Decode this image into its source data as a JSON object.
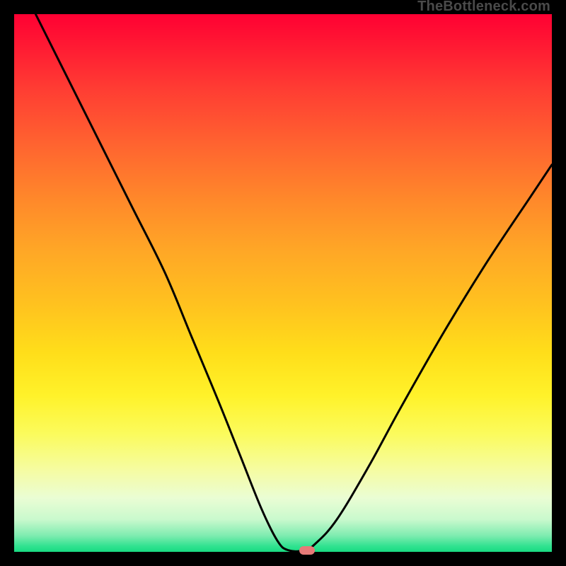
{
  "watermark": "TheBottleneck.com",
  "colors": {
    "frame": "#000000",
    "curve": "#000000",
    "marker": "#e67a78"
  },
  "chart_data": {
    "type": "line",
    "title": "",
    "xlabel": "",
    "ylabel": "",
    "xlim": [
      0,
      100
    ],
    "ylim": [
      0,
      100
    ],
    "grid": false,
    "curve_points_xy": [
      [
        4,
        100
      ],
      [
        10,
        88
      ],
      [
        16,
        76
      ],
      [
        22,
        64
      ],
      [
        28,
        52
      ],
      [
        33,
        40
      ],
      [
        38,
        28
      ],
      [
        42,
        18
      ],
      [
        46,
        8
      ],
      [
        49,
        2
      ],
      [
        51,
        0.3
      ],
      [
        54,
        0.3
      ],
      [
        56,
        1.5
      ],
      [
        60,
        6
      ],
      [
        66,
        16
      ],
      [
        72,
        27
      ],
      [
        80,
        41
      ],
      [
        88,
        54
      ],
      [
        96,
        66
      ],
      [
        100,
        72
      ]
    ],
    "marker_xy": [
      54.5,
      0.2
    ],
    "note": "x is horizontal position (% of plot width, 0=left, 100=right); y is the curve height above the green baseline (% of plot height, 0=bottom, 100=top). Values are estimated from the image since no axes/ticks are shown."
  }
}
